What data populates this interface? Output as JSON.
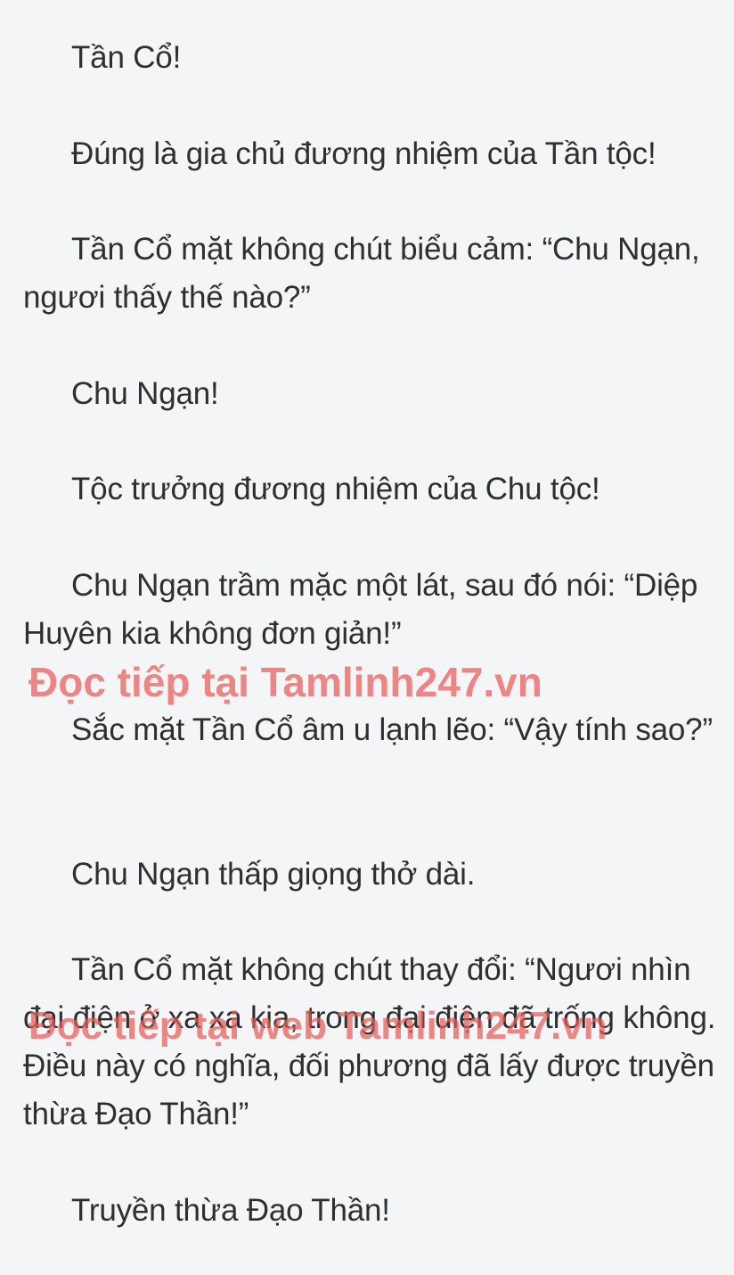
{
  "paragraphs": [
    "Tần Cổ!",
    "Đúng là gia chủ đương nhiệm của Tần tộc!",
    "Tần Cổ mặt không chút biểu cảm: “Chu Ngạn, ngươi thấy thế nào?”",
    "Chu Ngạn!",
    "Tộc trưởng đương nhiệm của Chu tộc!",
    "Chu Ngạn trầm mặc một lát, sau đó nói: “Diệp Huyên kia không đơn giản!”",
    "Sắc mặt Tần Cổ âm u lạnh lẽo: “Vậy tính sao?”",
    "Chu Ngạn thấp giọng thở dài.",
    "Tần Cổ mặt không chút thay đổi: “Ngươi nhìn đại điện ở xa xa kia, trong đại điện đã trống không. Điều này có nghĩa, đối phương đã lấy được truyền thừa Đạo Thần!”",
    "Truyền thừa Đạo Thần!"
  ],
  "watermarks": [
    "Đọc tiếp tại Tamlinh247.vn",
    "Đọc tiếp tại web Tamlinh247.vn"
  ],
  "colors": {
    "background": "#f4f5f7",
    "text": "#2f2f2f",
    "watermark": "#e85c58"
  }
}
